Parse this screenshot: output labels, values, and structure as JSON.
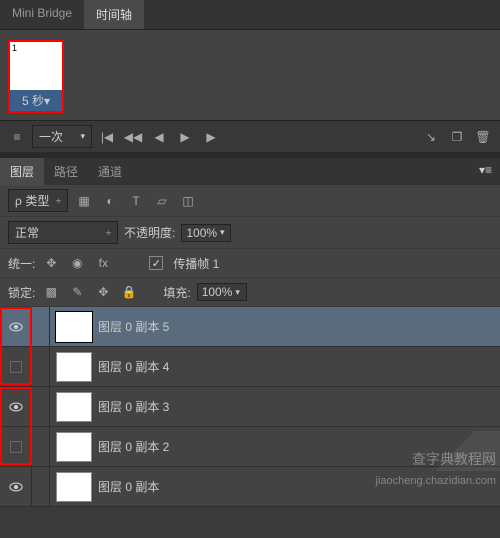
{
  "timeline": {
    "tabs": {
      "miniBridge": "Mini Bridge",
      "timeline": "时间轴"
    },
    "frame": {
      "number": "1",
      "time": "5 秒▾"
    },
    "loop": "一次"
  },
  "layersPanel": {
    "tabs": {
      "layers": "图层",
      "paths": "路径",
      "channels": "通道"
    },
    "kind": "类型",
    "blend": "正常",
    "opacityLabel": "不透明度:",
    "opacity": "100%",
    "unify": "统一:",
    "propagate": "传播帧 1",
    "lock": "锁定:",
    "fillLabel": "填充:",
    "fill": "100%",
    "layers": [
      {
        "name": "图层 0 副本 5",
        "visible": true,
        "selected": true
      },
      {
        "name": "图层 0 副本 4",
        "visible": false,
        "selected": false
      },
      {
        "name": "图层 0 副本 3",
        "visible": true,
        "selected": false
      },
      {
        "name": "图层 0 副本 2",
        "visible": false,
        "selected": false
      },
      {
        "name": "图层 0 副本",
        "visible": true,
        "selected": false
      }
    ]
  },
  "watermark": {
    "line1": "查字典教程网",
    "line2": "jiaocheng.chazidian.com"
  }
}
